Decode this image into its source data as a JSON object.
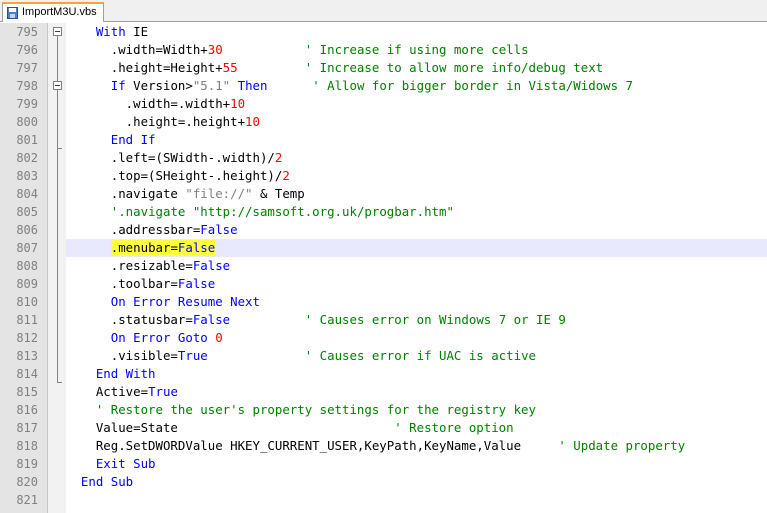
{
  "tab": {
    "label": "ImportM3U.vbs"
  },
  "highlight_color": "#ffff3f",
  "lines": [
    {
      "n": "795",
      "parts": [
        {
          "t": "    "
        },
        {
          "t": "With",
          "c": "kw"
        },
        {
          "t": " IE"
        }
      ]
    },
    {
      "n": "796",
      "parts": [
        {
          "t": "      .width=Width+"
        },
        {
          "t": "30",
          "c": "num"
        },
        {
          "t": "           "
        },
        {
          "t": "' Increase if using more cells",
          "c": "cmt"
        }
      ]
    },
    {
      "n": "797",
      "parts": [
        {
          "t": "      .height=Height+"
        },
        {
          "t": "55",
          "c": "num"
        },
        {
          "t": "         "
        },
        {
          "t": "' Increase to allow more info/debug text",
          "c": "cmt"
        }
      ]
    },
    {
      "n": "798",
      "parts": [
        {
          "t": "      "
        },
        {
          "t": "If",
          "c": "kw"
        },
        {
          "t": " Version>"
        },
        {
          "t": "\"5.1\"",
          "c": "str"
        },
        {
          "t": " "
        },
        {
          "t": "Then",
          "c": "kw"
        },
        {
          "t": "      "
        },
        {
          "t": "' Allow for bigger border in Vista/Widows 7",
          "c": "cmt"
        }
      ]
    },
    {
      "n": "799",
      "parts": [
        {
          "t": "        .width=.width+"
        },
        {
          "t": "10",
          "c": "num"
        }
      ]
    },
    {
      "n": "800",
      "parts": [
        {
          "t": "        .height=.height+"
        },
        {
          "t": "10",
          "c": "num"
        }
      ]
    },
    {
      "n": "801",
      "parts": [
        {
          "t": "      "
        },
        {
          "t": "End If",
          "c": "kw"
        }
      ]
    },
    {
      "n": "802",
      "parts": [
        {
          "t": "      .left=(SWidth-.width)/"
        },
        {
          "t": "2",
          "c": "num"
        }
      ]
    },
    {
      "n": "803",
      "parts": [
        {
          "t": "      .top=(SHeight-.height)/"
        },
        {
          "t": "2",
          "c": "num"
        }
      ]
    },
    {
      "n": "804",
      "parts": [
        {
          "t": "      .navigate "
        },
        {
          "t": "\"file://\"",
          "c": "str"
        },
        {
          "t": " & Temp"
        }
      ]
    },
    {
      "n": "805",
      "parts": [
        {
          "t": "      "
        },
        {
          "t": "'.navigate \"http://samsoft.org.uk/progbar.htm\"",
          "c": "cmt"
        }
      ]
    },
    {
      "n": "806",
      "parts": [
        {
          "t": "      .addressbar="
        },
        {
          "t": "False",
          "c": "kw"
        }
      ]
    },
    {
      "n": "807",
      "parts": [
        {
          "t": "      "
        },
        {
          "t": ".menubar=",
          "c": "hl"
        },
        {
          "t": "False",
          "c": "kw hl"
        }
      ]
    },
    {
      "n": "808",
      "parts": [
        {
          "t": "      .resizable="
        },
        {
          "t": "False",
          "c": "kw"
        }
      ]
    },
    {
      "n": "809",
      "parts": [
        {
          "t": "      .toolbar="
        },
        {
          "t": "False",
          "c": "kw"
        }
      ]
    },
    {
      "n": "810",
      "parts": [
        {
          "t": "      "
        },
        {
          "t": "On Error Resume Next",
          "c": "kw"
        }
      ]
    },
    {
      "n": "811",
      "parts": [
        {
          "t": "      .statusbar="
        },
        {
          "t": "False",
          "c": "kw"
        },
        {
          "t": "          "
        },
        {
          "t": "' Causes error on Windows 7 or IE 9",
          "c": "cmt"
        }
      ]
    },
    {
      "n": "812",
      "parts": [
        {
          "t": "      "
        },
        {
          "t": "On Error Goto",
          "c": "kw"
        },
        {
          "t": " "
        },
        {
          "t": "0",
          "c": "num"
        }
      ]
    },
    {
      "n": "813",
      "parts": [
        {
          "t": "      .visible="
        },
        {
          "t": "True",
          "c": "kw"
        },
        {
          "t": "             "
        },
        {
          "t": "' Causes error if UAC is active",
          "c": "cmt"
        }
      ]
    },
    {
      "n": "814",
      "parts": [
        {
          "t": "    "
        },
        {
          "t": "End With",
          "c": "kw"
        }
      ]
    },
    {
      "n": "815",
      "parts": [
        {
          "t": "    Active="
        },
        {
          "t": "True",
          "c": "kw"
        }
      ]
    },
    {
      "n": "816",
      "parts": [
        {
          "t": "    "
        },
        {
          "t": "' Restore the user's property settings for the registry key",
          "c": "cmt"
        }
      ]
    },
    {
      "n": "817",
      "parts": [
        {
          "t": "    Value=State                             "
        },
        {
          "t": "' Restore option",
          "c": "cmt"
        }
      ]
    },
    {
      "n": "818",
      "parts": [
        {
          "t": "    Reg.SetDWORDValue HKEY_CURRENT_USER,KeyPath,KeyName,Value     "
        },
        {
          "t": "' Update property",
          "c": "cmt"
        }
      ]
    },
    {
      "n": "819",
      "parts": [
        {
          "t": "    "
        },
        {
          "t": "Exit Sub",
          "c": "kw"
        }
      ]
    },
    {
      "n": "820",
      "parts": [
        {
          "t": "  "
        },
        {
          "t": "End Sub",
          "c": "kw"
        }
      ]
    },
    {
      "n": "821",
      "parts": []
    }
  ]
}
